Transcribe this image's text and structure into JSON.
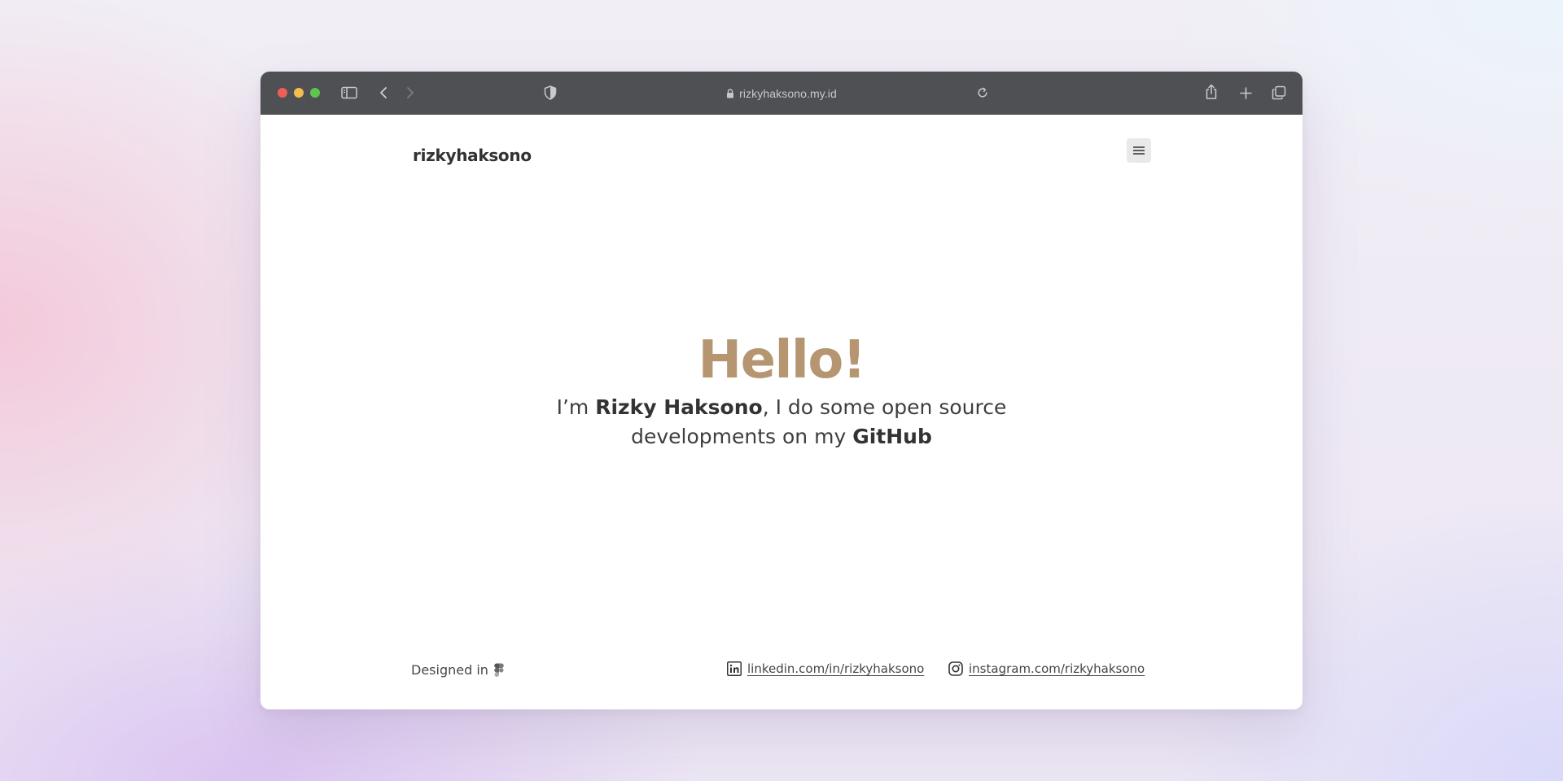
{
  "browser": {
    "url": "rizkyhaksono.my.id",
    "icons": [
      "sidebar-icon",
      "back-icon",
      "forward-icon",
      "privacy-shield-icon",
      "lock-icon",
      "reload-icon",
      "share-icon",
      "new-tab-icon",
      "tabs-overview-icon"
    ]
  },
  "site": {
    "logo": "rizkyhaksono",
    "menu_icon": "hamburger-menu-icon"
  },
  "hero": {
    "title": "Hello!",
    "intro_prefix": "I’m ",
    "name": "Rizky Haksono",
    "intro_middle": ", I do some open source developments on my ",
    "github": "GitHub"
  },
  "footer": {
    "designed_in": "Designed in",
    "designed_in_icon": "figma-icon",
    "linkedin": "linkedin.com/in/rizkyhaksono",
    "instagram": "instagram.com/rizkyhaksono"
  },
  "colors": {
    "accent": "#b59671",
    "text": "#333333",
    "toolbar": "#4f5054"
  }
}
